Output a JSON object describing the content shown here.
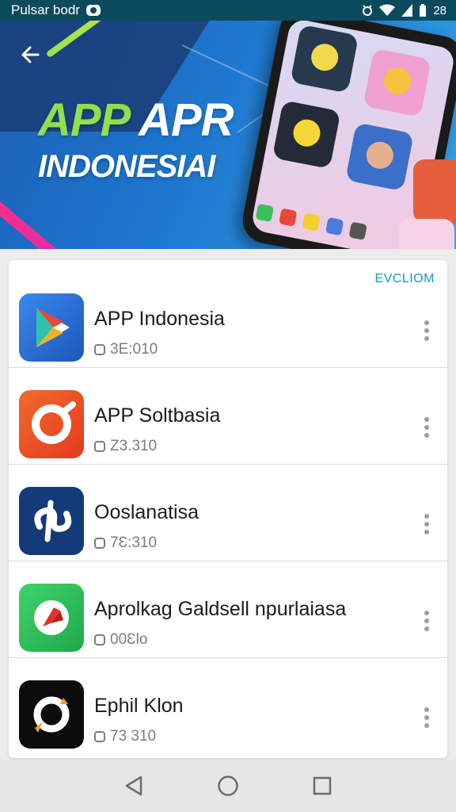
{
  "status_bar": {
    "carrier": "Pulsar bodr",
    "right_text": "28"
  },
  "hero": {
    "title_accent": "APP",
    "title_rest": "APR",
    "subtitle": "INDONESIAI"
  },
  "list": {
    "section_label": "EVCLIOM",
    "items": [
      {
        "name": "APP Indonesia",
        "meta": "3E:010",
        "icon": "play-store-icon",
        "color": "#2f6fd6"
      },
      {
        "name": "APP Soltbasia",
        "meta": "Z3.310",
        "icon": "ring-logo-icon",
        "color": "#ef4a25"
      },
      {
        "name": "Ooslanatisa",
        "meta": "7Ɛ:310",
        "icon": "knot-logo-icon",
        "color": "#143a7a"
      },
      {
        "name": "Aprolkag Galdsell npurlaiasa",
        "meta": "00Ɛlo",
        "icon": "compass-logo-icon",
        "color": "#2fbd5a"
      },
      {
        "name": "Ephil Klon",
        "meta": "73 310",
        "icon": "spiral-logo-icon",
        "color": "#0c0c0c"
      }
    ]
  },
  "nav": {
    "back": "back-nav-icon",
    "home": "home-nav-icon",
    "recents": "recents-nav-icon"
  }
}
